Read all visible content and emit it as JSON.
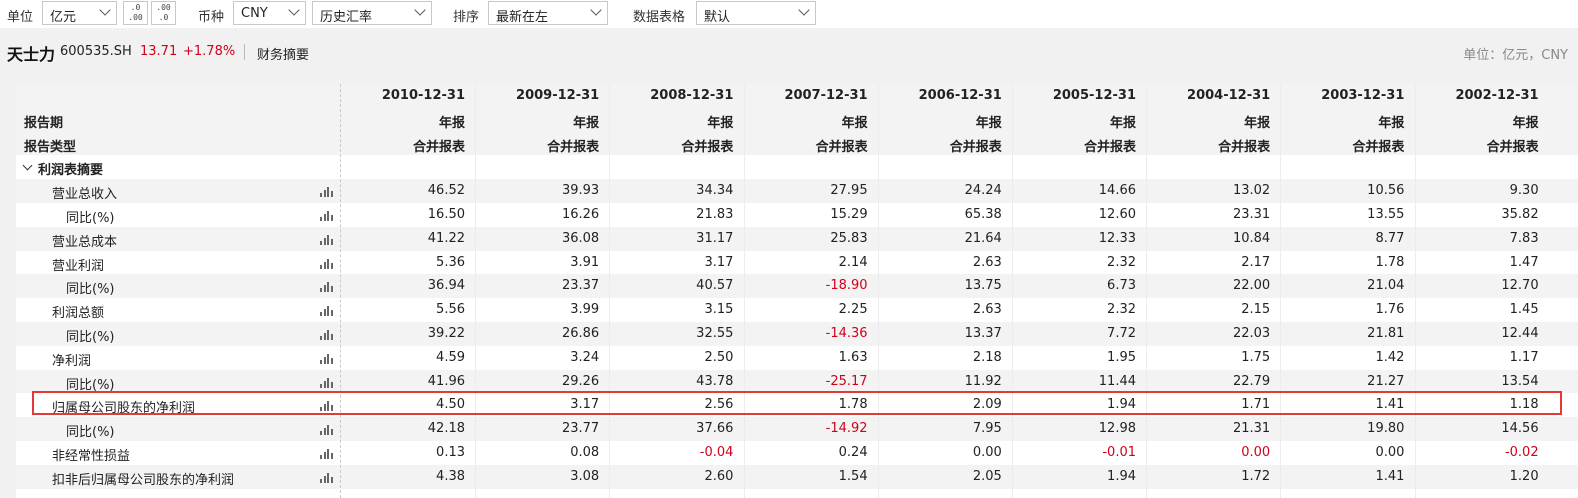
{
  "toolbar": {
    "unit_label": "单位",
    "unit_value": "亿元",
    "dec_inc_label": ".0\n.00",
    "dec_dec_label": ".00\n.0",
    "currency_label": "币种",
    "currency_value": "CNY",
    "rate_value": "历史汇率",
    "sort_label": "排序",
    "sort_value": "最新在左",
    "format_label": "数据表格",
    "format_value": "默认"
  },
  "header": {
    "name": "天士力",
    "code": "600535.SH",
    "price": "13.71",
    "change": "+1.78%",
    "title": "财务摘要",
    "unit_note": "单位：亿元，CNY"
  },
  "table": {
    "period_label": "报告期",
    "type_label": "报告类型",
    "columns": [
      {
        "date": "2010-12-31",
        "period": "年报",
        "type": "合并报表"
      },
      {
        "date": "2009-12-31",
        "period": "年报",
        "type": "合并报表"
      },
      {
        "date": "2008-12-31",
        "period": "年报",
        "type": "合并报表"
      },
      {
        "date": "2007-12-31",
        "period": "年报",
        "type": "合并报表"
      },
      {
        "date": "2006-12-31",
        "period": "年报",
        "type": "合并报表"
      },
      {
        "date": "2005-12-31",
        "period": "年报",
        "type": "合并报表"
      },
      {
        "date": "2004-12-31",
        "period": "年报",
        "type": "合并报表"
      },
      {
        "date": "2003-12-31",
        "period": "年报",
        "type": "合并报表"
      },
      {
        "date": "2002-12-31",
        "period": "年报",
        "type": "合并报表"
      }
    ],
    "section_title": "利润表摘要",
    "rows": [
      {
        "label": "营业总收入",
        "indent": 1,
        "values": [
          "46.52",
          "39.93",
          "34.34",
          "27.95",
          "24.24",
          "14.66",
          "13.02",
          "10.56",
          "9.30"
        ]
      },
      {
        "label": "同比(%)",
        "indent": 2,
        "values": [
          "16.50",
          "16.26",
          "21.83",
          "15.29",
          "65.38",
          "12.60",
          "23.31",
          "13.55",
          "35.82"
        ]
      },
      {
        "label": "营业总成本",
        "indent": 1,
        "values": [
          "41.22",
          "36.08",
          "31.17",
          "25.83",
          "21.64",
          "12.33",
          "10.84",
          "8.77",
          "7.83"
        ]
      },
      {
        "label": "营业利润",
        "indent": 1,
        "values": [
          "5.36",
          "3.91",
          "3.17",
          "2.14",
          "2.63",
          "2.32",
          "2.17",
          "1.78",
          "1.47"
        ]
      },
      {
        "label": "同比(%)",
        "indent": 2,
        "values": [
          "36.94",
          "23.37",
          "40.57",
          "-18.90",
          "13.75",
          "6.73",
          "22.00",
          "21.04",
          "12.70"
        ]
      },
      {
        "label": "利润总额",
        "indent": 1,
        "values": [
          "5.56",
          "3.99",
          "3.15",
          "2.25",
          "2.63",
          "2.32",
          "2.15",
          "1.76",
          "1.45"
        ]
      },
      {
        "label": "同比(%)",
        "indent": 2,
        "values": [
          "39.22",
          "26.86",
          "32.55",
          "-14.36",
          "13.37",
          "7.72",
          "22.03",
          "21.81",
          "12.44"
        ]
      },
      {
        "label": "净利润",
        "indent": 1,
        "values": [
          "4.59",
          "3.24",
          "2.50",
          "1.63",
          "2.18",
          "1.95",
          "1.75",
          "1.42",
          "1.17"
        ]
      },
      {
        "label": "同比(%)",
        "indent": 2,
        "values": [
          "41.96",
          "29.26",
          "43.78",
          "-25.17",
          "11.92",
          "11.44",
          "22.79",
          "21.27",
          "13.54"
        ]
      },
      {
        "label": "归属母公司股东的净利润",
        "indent": 1,
        "values": [
          "4.50",
          "3.17",
          "2.56",
          "1.78",
          "2.09",
          "1.94",
          "1.71",
          "1.41",
          "1.18"
        ]
      },
      {
        "label": "同比(%)",
        "indent": 2,
        "values": [
          "42.18",
          "23.77",
          "37.66",
          "-14.92",
          "7.95",
          "12.98",
          "21.31",
          "19.80",
          "14.56"
        ]
      },
      {
        "label": "非经常性损益",
        "indent": 1,
        "values": [
          "0.13",
          "0.08",
          "-0.04",
          "0.24",
          "0.00",
          "-0.01",
          "0.00",
          "0.00",
          "-0.02"
        ],
        "red_cells": [
          2,
          5,
          6,
          8
        ]
      },
      {
        "label": "扣非后归属母公司股东的净利润",
        "indent": 1,
        "values": [
          "4.38",
          "3.08",
          "2.60",
          "1.54",
          "2.05",
          "1.94",
          "1.72",
          "1.41",
          "1.20"
        ]
      }
    ]
  },
  "colors": {
    "negative": "#d0021b",
    "highlight_border": "#e53935"
  }
}
